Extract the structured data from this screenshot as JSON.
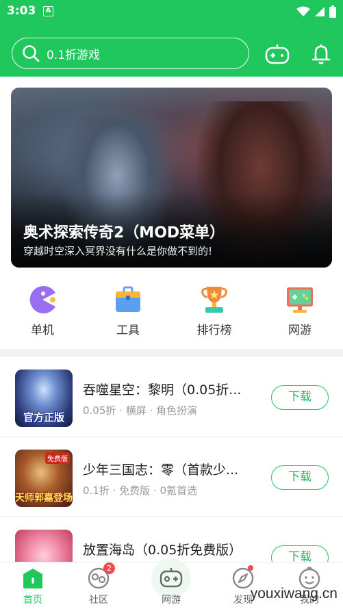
{
  "status_bar": {
    "time": "3:03",
    "notification_letter": "A"
  },
  "header": {
    "search_placeholder": "0.1折游戏",
    "icons": [
      "search-icon",
      "gamepad-icon",
      "bell-icon"
    ]
  },
  "banner": {
    "title": "奥术探索传奇2（MOD菜单）",
    "subtitle": "穿越时空深入冥界没有什么是你做不到的!"
  },
  "categories": [
    {
      "label": "单机",
      "icon": "pacman-icon"
    },
    {
      "label": "工具",
      "icon": "toolbox-icon"
    },
    {
      "label": "排行榜",
      "icon": "trophy-icon"
    },
    {
      "label": "网游",
      "icon": "monitor-game-icon"
    }
  ],
  "games": [
    {
      "title": "吞噬星空：黎明（0.05折...",
      "tags": "0.05折 · 横屏 · 角色扮演",
      "button": "下载",
      "thumb_text": "官方正版"
    },
    {
      "title": "少年三国志：零（首款少...",
      "tags": "0.1折 · 免费版 · 0氪首选",
      "button": "下载",
      "thumb_text": "天师郭嘉登场",
      "thumb_badge": "免费版"
    },
    {
      "title": "放置海岛（0.05折免费版）",
      "tags": "",
      "button": "下载"
    }
  ],
  "bottom_nav": [
    {
      "label": "首页",
      "active": true
    },
    {
      "label": "社区",
      "badge": "2"
    },
    {
      "label": "网游"
    },
    {
      "label": "发现",
      "dot": true
    },
    {
      "label": "我的"
    }
  ],
  "watermark": "youxiwang.cn",
  "colors": {
    "brand_green": "#1fc75c",
    "badge_red": "#f04b4b"
  }
}
